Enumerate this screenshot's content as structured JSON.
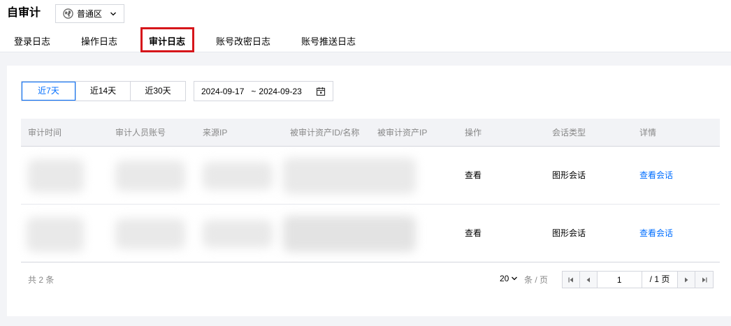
{
  "header": {
    "title": "自审计",
    "region": "普通区"
  },
  "tabs": [
    {
      "label": "登录日志",
      "active": false
    },
    {
      "label": "操作日志",
      "active": false
    },
    {
      "label": "审计日志",
      "active": true
    },
    {
      "label": "账号改密日志",
      "active": false
    },
    {
      "label": "账号推送日志",
      "active": false
    }
  ],
  "filters": {
    "ranges": [
      "近7天",
      "近14天",
      "近30天"
    ],
    "active_range": "近7天",
    "date_start": "2024-09-17",
    "date_sep": "~",
    "date_end": "2024-09-23"
  },
  "table": {
    "columns": [
      "审计时间",
      "审计人员账号",
      "来源IP",
      "被审计资产ID/名称",
      "被审计资产IP",
      "操作",
      "会话类型",
      "详情"
    ],
    "rows": [
      {
        "action": "查看",
        "session_type": "图形会话",
        "detail": "查看会话"
      },
      {
        "action": "查看",
        "session_type": "图形会话",
        "detail": "查看会话"
      }
    ]
  },
  "pagination": {
    "total_text": "共 2 条",
    "page_size": "20",
    "per_page_label": "条 / 页",
    "current_page": "1",
    "total_pages": "/ 1 页"
  },
  "colors": {
    "accent": "#006eff",
    "highlight": "#d6161b"
  }
}
